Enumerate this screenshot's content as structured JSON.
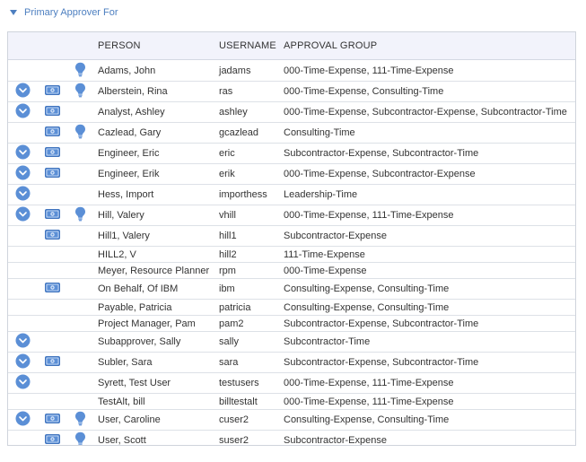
{
  "section": {
    "title": "Primary Approver For"
  },
  "columns": {
    "person": "PERSON",
    "username": "USERNAME",
    "group": "APPROVAL GROUP"
  },
  "colors": {
    "accent": "#4d7fc0",
    "icon_blue": "#5b8fd6",
    "header_bg": "#f2f3fb"
  },
  "rows": [
    {
      "person": "Adams, John",
      "username": "jadams",
      "group": "000-Time-Expense, 111-Time-Expense",
      "icons": [
        "bulb-icon"
      ]
    },
    {
      "person": "Alberstein, Rina",
      "username": "ras",
      "group": "000-Time-Expense, Consulting-Time",
      "icons": [
        "chevron-circle-icon",
        "money-icon",
        "bulb-icon"
      ]
    },
    {
      "person": "Analyst, Ashley",
      "username": "ashley",
      "group": "000-Time-Expense, Subcontractor-Expense, Subcontractor-Time",
      "icons": [
        "chevron-circle-icon",
        "money-icon"
      ]
    },
    {
      "person": "Cazlead, Gary",
      "username": "gcazlead",
      "group": "Consulting-Time",
      "icons": [
        "money-icon",
        "bulb-icon"
      ]
    },
    {
      "person": "Engineer, Eric",
      "username": "eric",
      "group": "Subcontractor-Expense, Subcontractor-Time",
      "icons": [
        "chevron-circle-icon",
        "money-icon"
      ]
    },
    {
      "person": "Engineer, Erik",
      "username": "erik",
      "group": "000-Time-Expense, Subcontractor-Expense",
      "icons": [
        "chevron-circle-icon",
        "money-icon"
      ]
    },
    {
      "person": "Hess, Import",
      "username": "importhess",
      "group": "Leadership-Time",
      "icons": [
        "chevron-circle-icon"
      ]
    },
    {
      "person": "Hill, Valery",
      "username": "vhill",
      "group": "000-Time-Expense, 111-Time-Expense",
      "icons": [
        "chevron-circle-icon",
        "money-icon",
        "bulb-icon"
      ]
    },
    {
      "person": "Hill1, Valery",
      "username": "hill1",
      "group": "Subcontractor-Expense",
      "icons": [
        "money-icon"
      ]
    },
    {
      "person": "HILL2, V",
      "username": "hill2",
      "group": "111-Time-Expense",
      "icons": []
    },
    {
      "person": "Meyer, Resource Planner",
      "username": "rpm",
      "group": "000-Time-Expense",
      "icons": []
    },
    {
      "person": "On Behalf, Of IBM",
      "username": "ibm",
      "group": "Consulting-Expense, Consulting-Time",
      "icons": [
        "money-icon"
      ]
    },
    {
      "person": "Payable, Patricia",
      "username": "patricia",
      "group": "Consulting-Expense, Consulting-Time",
      "icons": []
    },
    {
      "person": "Project Manager, Pam",
      "username": "pam2",
      "group": "Subcontractor-Expense, Subcontractor-Time",
      "icons": []
    },
    {
      "person": "Subapprover, Sally",
      "username": "sally",
      "group": "Subcontractor-Time",
      "icons": [
        "chevron-circle-icon"
      ]
    },
    {
      "person": "Subler, Sara",
      "username": "sara",
      "group": "Subcontractor-Expense, Subcontractor-Time",
      "icons": [
        "chevron-circle-icon",
        "money-icon"
      ]
    },
    {
      "person": "Syrett, Test User",
      "username": "testusers",
      "group": "000-Time-Expense, 111-Time-Expense",
      "icons": [
        "chevron-circle-icon"
      ]
    },
    {
      "person": "TestAlt, bill",
      "username": "billtestalt",
      "group": "000-Time-Expense, 111-Time-Expense",
      "icons": []
    },
    {
      "person": "User, Caroline",
      "username": "cuser2",
      "group": "Consulting-Expense, Consulting-Time",
      "icons": [
        "chevron-circle-icon",
        "money-icon",
        "bulb-icon"
      ]
    },
    {
      "person": "User, Scott",
      "username": "suser2",
      "group": "Subcontractor-Expense",
      "icons": [
        "money-icon",
        "bulb-icon"
      ]
    }
  ]
}
